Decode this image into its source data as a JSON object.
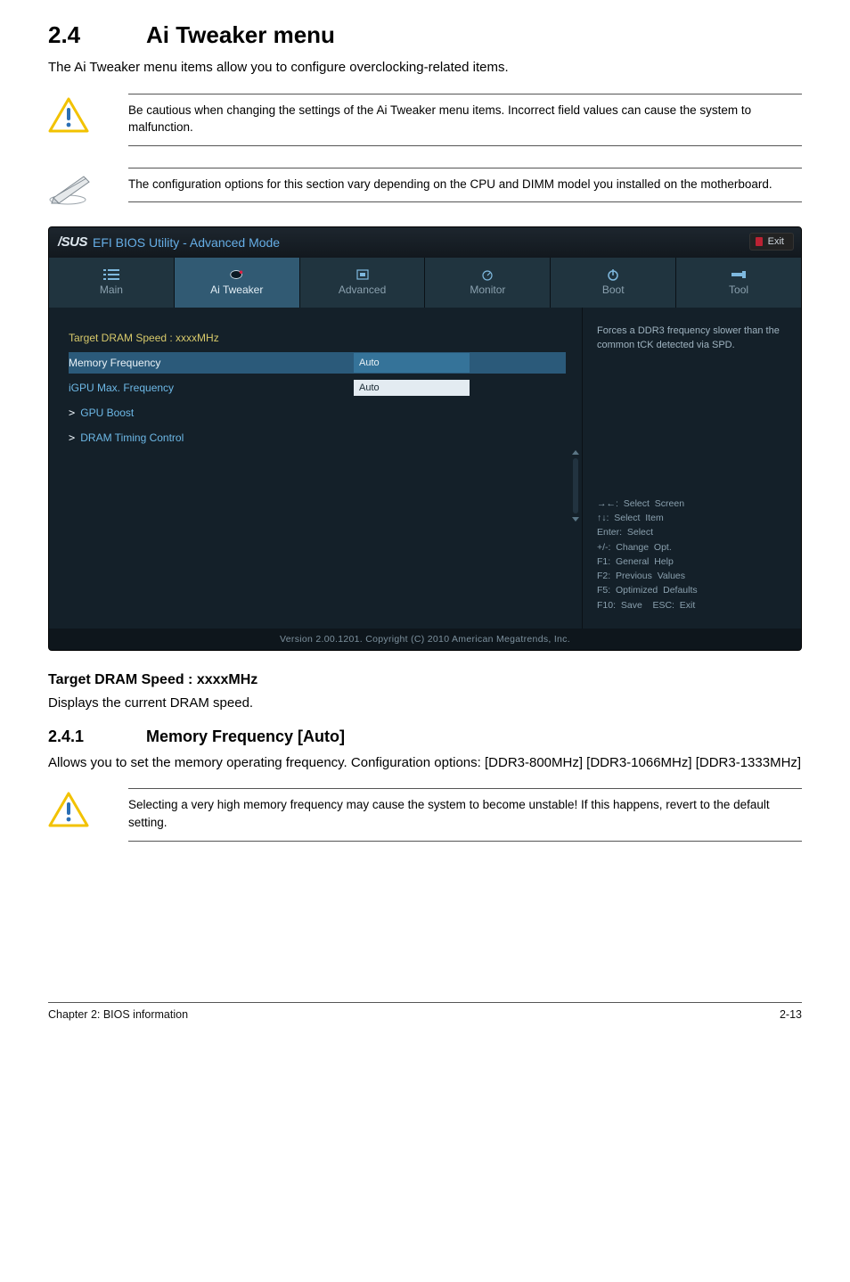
{
  "section": {
    "num": "2.4",
    "title": "Ai Tweaker menu"
  },
  "intro": "The Ai Tweaker menu items allow you to configure overclocking-related items.",
  "caution1": "Be cautious when changing the settings of the Ai Tweaker menu items. Incorrect field values can cause the system to malfunction.",
  "note1": "The configuration options for this section vary depending on the CPU and DIMM model you installed on the motherboard.",
  "bios": {
    "logo": "/SUS",
    "title": "EFI BIOS Utility - Advanced Mode",
    "exit": "Exit",
    "tabs": {
      "main": "Main",
      "ai": "Ai  Tweaker",
      "adv": "Advanced",
      "mon": "Monitor",
      "boot": "Boot",
      "tool": "Tool"
    },
    "rows": {
      "target": "Target DRAM Speed : xxxxMHz",
      "memfreq_label": "Memory Frequency",
      "memfreq_val": "Auto",
      "igpu_label": "iGPU Max. Frequency",
      "igpu_val": "Auto",
      "gpuboost": "GPU Boost",
      "dramtc": "DRAM Timing Control"
    },
    "right_info": "Forces a DDR3 frequency slower than the common tCK detected via SPD.",
    "help": {
      "l1": "→←:  Select  Screen",
      "l2": "↑↓:  Select  Item",
      "l3": "Enter:  Select",
      "l4": "+/-:  Change  Opt.",
      "l5": "F1:  General  Help",
      "l6": "F2:  Previous  Values",
      "l7": "F5:  Optimized  Defaults",
      "l8": "F10:  Save    ESC:  Exit"
    },
    "footer": "Version  2.00.1201.   Copyright  (C)  2010  American  Megatrends,  Inc."
  },
  "target_heading": "Target DRAM Speed : xxxxMHz",
  "target_body": "Displays the current DRAM speed.",
  "subsection": {
    "num": "2.4.1",
    "title": "Memory Frequency [Auto]"
  },
  "subsection_body": "Allows you to set the memory operating frequency. Configuration options: [DDR3-800MHz] [DDR3-1066MHz] [DDR3-1333MHz]",
  "caution2": "Selecting a very high memory frequency may cause the system to become unstable! If this happens, revert to the default setting.",
  "footer": {
    "left": "Chapter 2: BIOS information",
    "right": "2-13"
  }
}
